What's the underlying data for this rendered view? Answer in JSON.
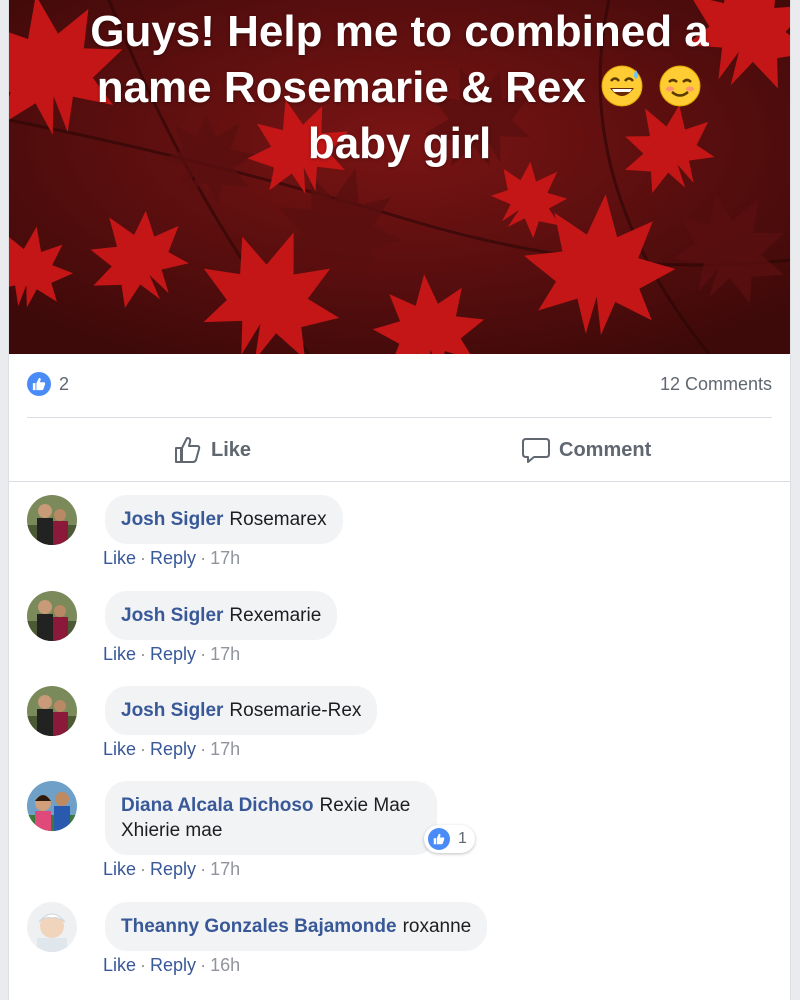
{
  "post": {
    "text_line1": "Guys! Help me to combined a",
    "text_line2": "name Rosemarie & Rex",
    "text_line3": "baby girl",
    "emojis": [
      "sweat-smile-emoji",
      "smiling-blush-emoji"
    ],
    "background_color": "#8b1010",
    "like_count": "2",
    "comment_count": "12 Comments"
  },
  "actions": {
    "like_label": "Like",
    "comment_label": "Comment"
  },
  "comments": [
    {
      "author": "Josh Sigler",
      "text": "Rosemarex",
      "like": "Like",
      "reply": "Reply",
      "time": "17h"
    },
    {
      "author": "Josh Sigler",
      "text": "Rexemarie",
      "like": "Like",
      "reply": "Reply",
      "time": "17h"
    },
    {
      "author": "Josh Sigler",
      "text": "Rosemarie-Rex",
      "like": "Like",
      "reply": "Reply",
      "time": "17h"
    },
    {
      "author": "Diana Alcala Dichoso",
      "text": "Rexie Mae",
      "text2": "Xhierie mae",
      "like": "Like",
      "reply": "Reply",
      "time": "17h",
      "reactions": "1"
    },
    {
      "author": "Theanny Gonzales Bajamonde",
      "text": "roxanne",
      "like": "Like",
      "reply": "Reply",
      "time": "16h"
    }
  ],
  "colors": {
    "link": "#385898",
    "accent": "#4a8cf7",
    "bubble": "#f2f3f5"
  }
}
